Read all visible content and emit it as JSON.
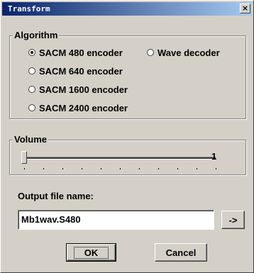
{
  "window": {
    "title": "Transform",
    "close_glyph": "×"
  },
  "algorithm": {
    "label": "Algorithm",
    "options": [
      {
        "label": "SACM 480 encoder",
        "checked": true
      },
      {
        "label": "SACM 640 encoder",
        "checked": false
      },
      {
        "label": "SACM 1600 encoder",
        "checked": false
      },
      {
        "label": "SACM 2400 encoder",
        "checked": false
      },
      {
        "label": "Wave decoder",
        "checked": false
      }
    ]
  },
  "volume": {
    "label": "Volume",
    "value": "1",
    "level": 0
  },
  "output": {
    "label": "Output file name:",
    "value": "Mb1wav.S480",
    "browse_label": "->"
  },
  "buttons": {
    "ok": "OK",
    "cancel": "Cancel"
  }
}
